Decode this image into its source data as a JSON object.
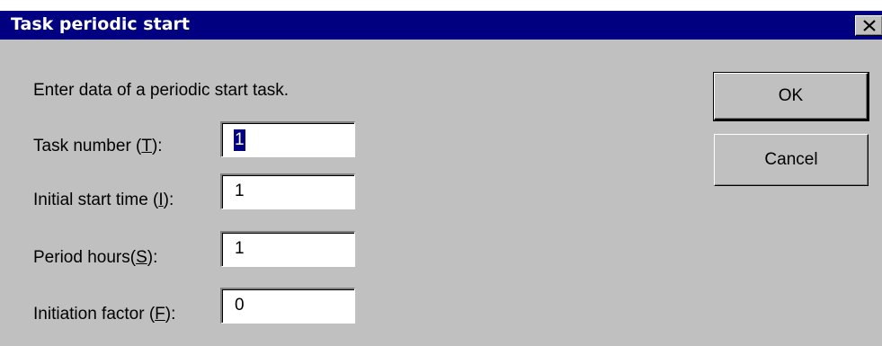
{
  "dialog": {
    "title": "Task periodic start",
    "instruction": "Enter data of a periodic start task.",
    "fields": [
      {
        "label": "Task number (",
        "mnemonic": "T",
        "label_end": "):",
        "value": "1"
      },
      {
        "label": "Initial start time (",
        "mnemonic": "I",
        "label_end": "):",
        "value": "1"
      },
      {
        "label": "Period hours(",
        "mnemonic": "S",
        "label_end": "):",
        "value": "1"
      },
      {
        "label": "Initiation factor (",
        "mnemonic": "F",
        "label_end": "):",
        "value": "0"
      }
    ],
    "buttons": {
      "ok": "OK",
      "cancel": "Cancel"
    }
  },
  "icons": {
    "close": "close-icon"
  },
  "colors": {
    "titlebar": "#000080",
    "face": "#c0c0c0",
    "selection": "#000080"
  }
}
